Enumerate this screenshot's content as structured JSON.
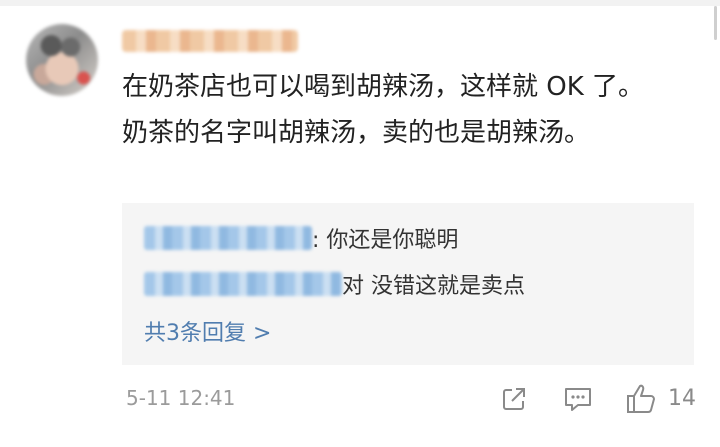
{
  "comment": {
    "text": "在奶茶店也可以喝到胡辣汤，这样就 OK 了。奶茶的名字叫胡辣汤，卖的也是胡辣汤。"
  },
  "replies": [
    {
      "text": ": 你还是你聪明"
    },
    {
      "text": " 对 没错这就是卖点"
    }
  ],
  "more_replies_label": "共3条回复 >",
  "time": "5-11 12:41",
  "actions": {
    "like_count": "14",
    "icons": [
      "share-icon",
      "comment-icon",
      "like-icon"
    ]
  },
  "colors": {
    "link": "#507daf",
    "reply_bg": "#f5f5f5",
    "text": "#222222",
    "muted": "#9b9b9b"
  }
}
